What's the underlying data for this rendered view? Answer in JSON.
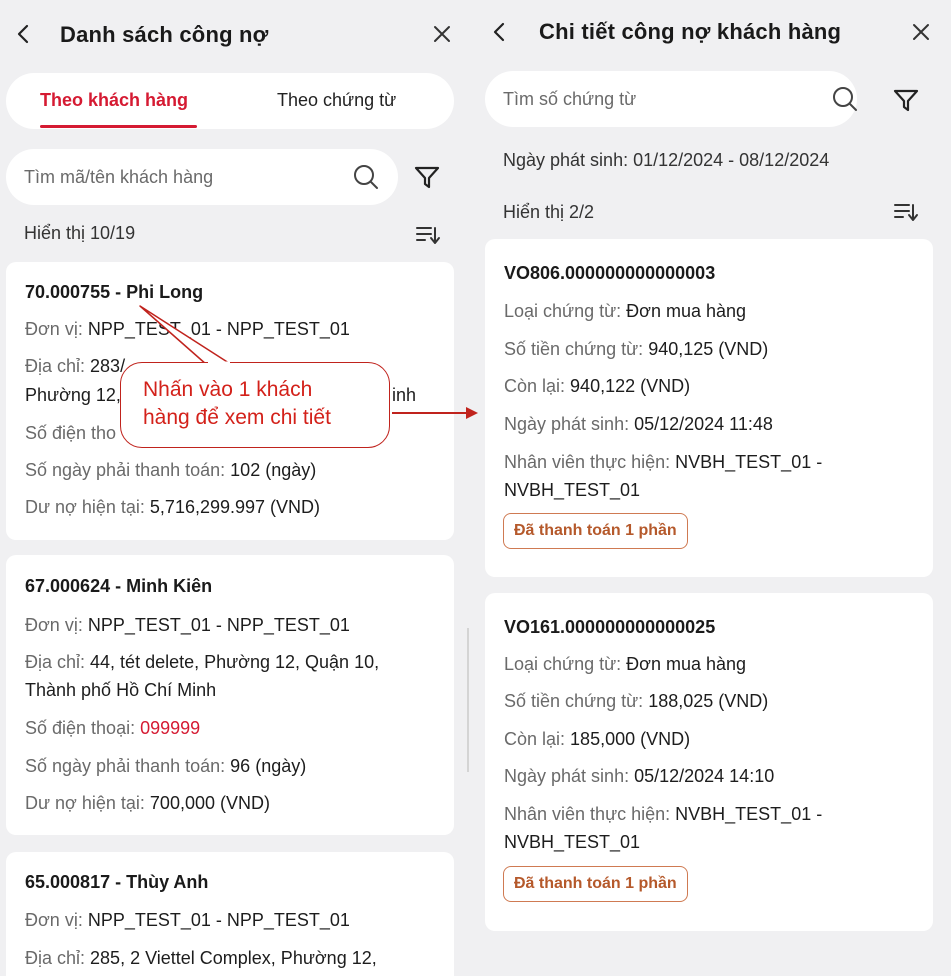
{
  "left": {
    "title": "Danh sách công nợ",
    "tabs": [
      {
        "label": "Theo khách hàng",
        "active": true
      },
      {
        "label": "Theo chứng từ",
        "active": false
      }
    ],
    "search_placeholder": "Tìm mã/tên khách hàng",
    "count_text": "Hiển thị 10/19",
    "labels": {
      "unit": "Đơn vị: ",
      "address": "Địa chỉ: ",
      "phone": "Số điện thoại: ",
      "days": "Số ngày phải thanh toán: ",
      "debt": "Dư nợ hiện tại: "
    },
    "customers": [
      {
        "title": "70.000755 - Phi Long",
        "unit": "NPP_TEST_01 - NPP_TEST_01",
        "address_line1_visible": "283/",
        "address_line2_start": "Phường 12,",
        "address_line2_end": "inh",
        "phone_label_visible": "Số điện tho",
        "days": "102 (ngày)",
        "debt": "5,716,299.997 (VND)"
      },
      {
        "title": "67.000624 - Minh Kiên",
        "unit": "NPP_TEST_01 - NPP_TEST_01",
        "address_line1": "44, tét delete, Phường 12, Quận 10,",
        "address_line2": "Thành phố Hồ Chí Minh",
        "phone": "099999",
        "days": "96 (ngày)",
        "debt": "700,000 (VND)"
      },
      {
        "title": "65.000817 - Thùy Anh",
        "unit": "NPP_TEST_01 - NPP_TEST_01",
        "address_line1": "285, 2 Viettel Complex, Phường 12,"
      }
    ]
  },
  "right": {
    "title": "Chi tiết công nợ khách hàng",
    "search_placeholder": "Tìm số chứng từ",
    "date_range": "Ngày phát sinh: 01/12/2024 - 08/12/2024",
    "count_text": "Hiển thị 2/2",
    "labels": {
      "doc_type": "Loại chứng từ: ",
      "amount": "Số tiền chứng từ: ",
      "remaining": "Còn lại: ",
      "date": "Ngày phát sinh: ",
      "staff": "Nhân viên thực hiện: "
    },
    "documents": [
      {
        "title": "VO806.000000000000003",
        "doc_type": "Đơn mua hàng",
        "amount": "940,125 (VND)",
        "remaining": "940,122 (VND)",
        "date": "05/12/2024 11:48",
        "staff_line1": "NVBH_TEST_01 -",
        "staff_line2": "NVBH_TEST_01",
        "status": "Đã thanh toán 1 phần"
      },
      {
        "title": "VO161.000000000000025",
        "doc_type": "Đơn mua hàng",
        "amount": "188,025 (VND)",
        "remaining": "185,000 (VND)",
        "date": "05/12/2024 14:10",
        "staff_line1": "NVBH_TEST_01 -",
        "staff_line2": "NVBH_TEST_01",
        "status": "Đã thanh toán 1 phần"
      }
    ]
  },
  "callout": {
    "line1": "Nhấn vào 1 khách",
    "line2": "hàng để xem chi tiết"
  },
  "colors": {
    "accent": "#d51a32",
    "badge_border": "#cf7a52",
    "badge_text": "#b5592b",
    "callout": "#c0231d",
    "background": "#f0f0f2"
  },
  "icons": [
    "back-arrow-icon",
    "close-icon",
    "search-icon",
    "filter-icon",
    "sort-icon"
  ]
}
